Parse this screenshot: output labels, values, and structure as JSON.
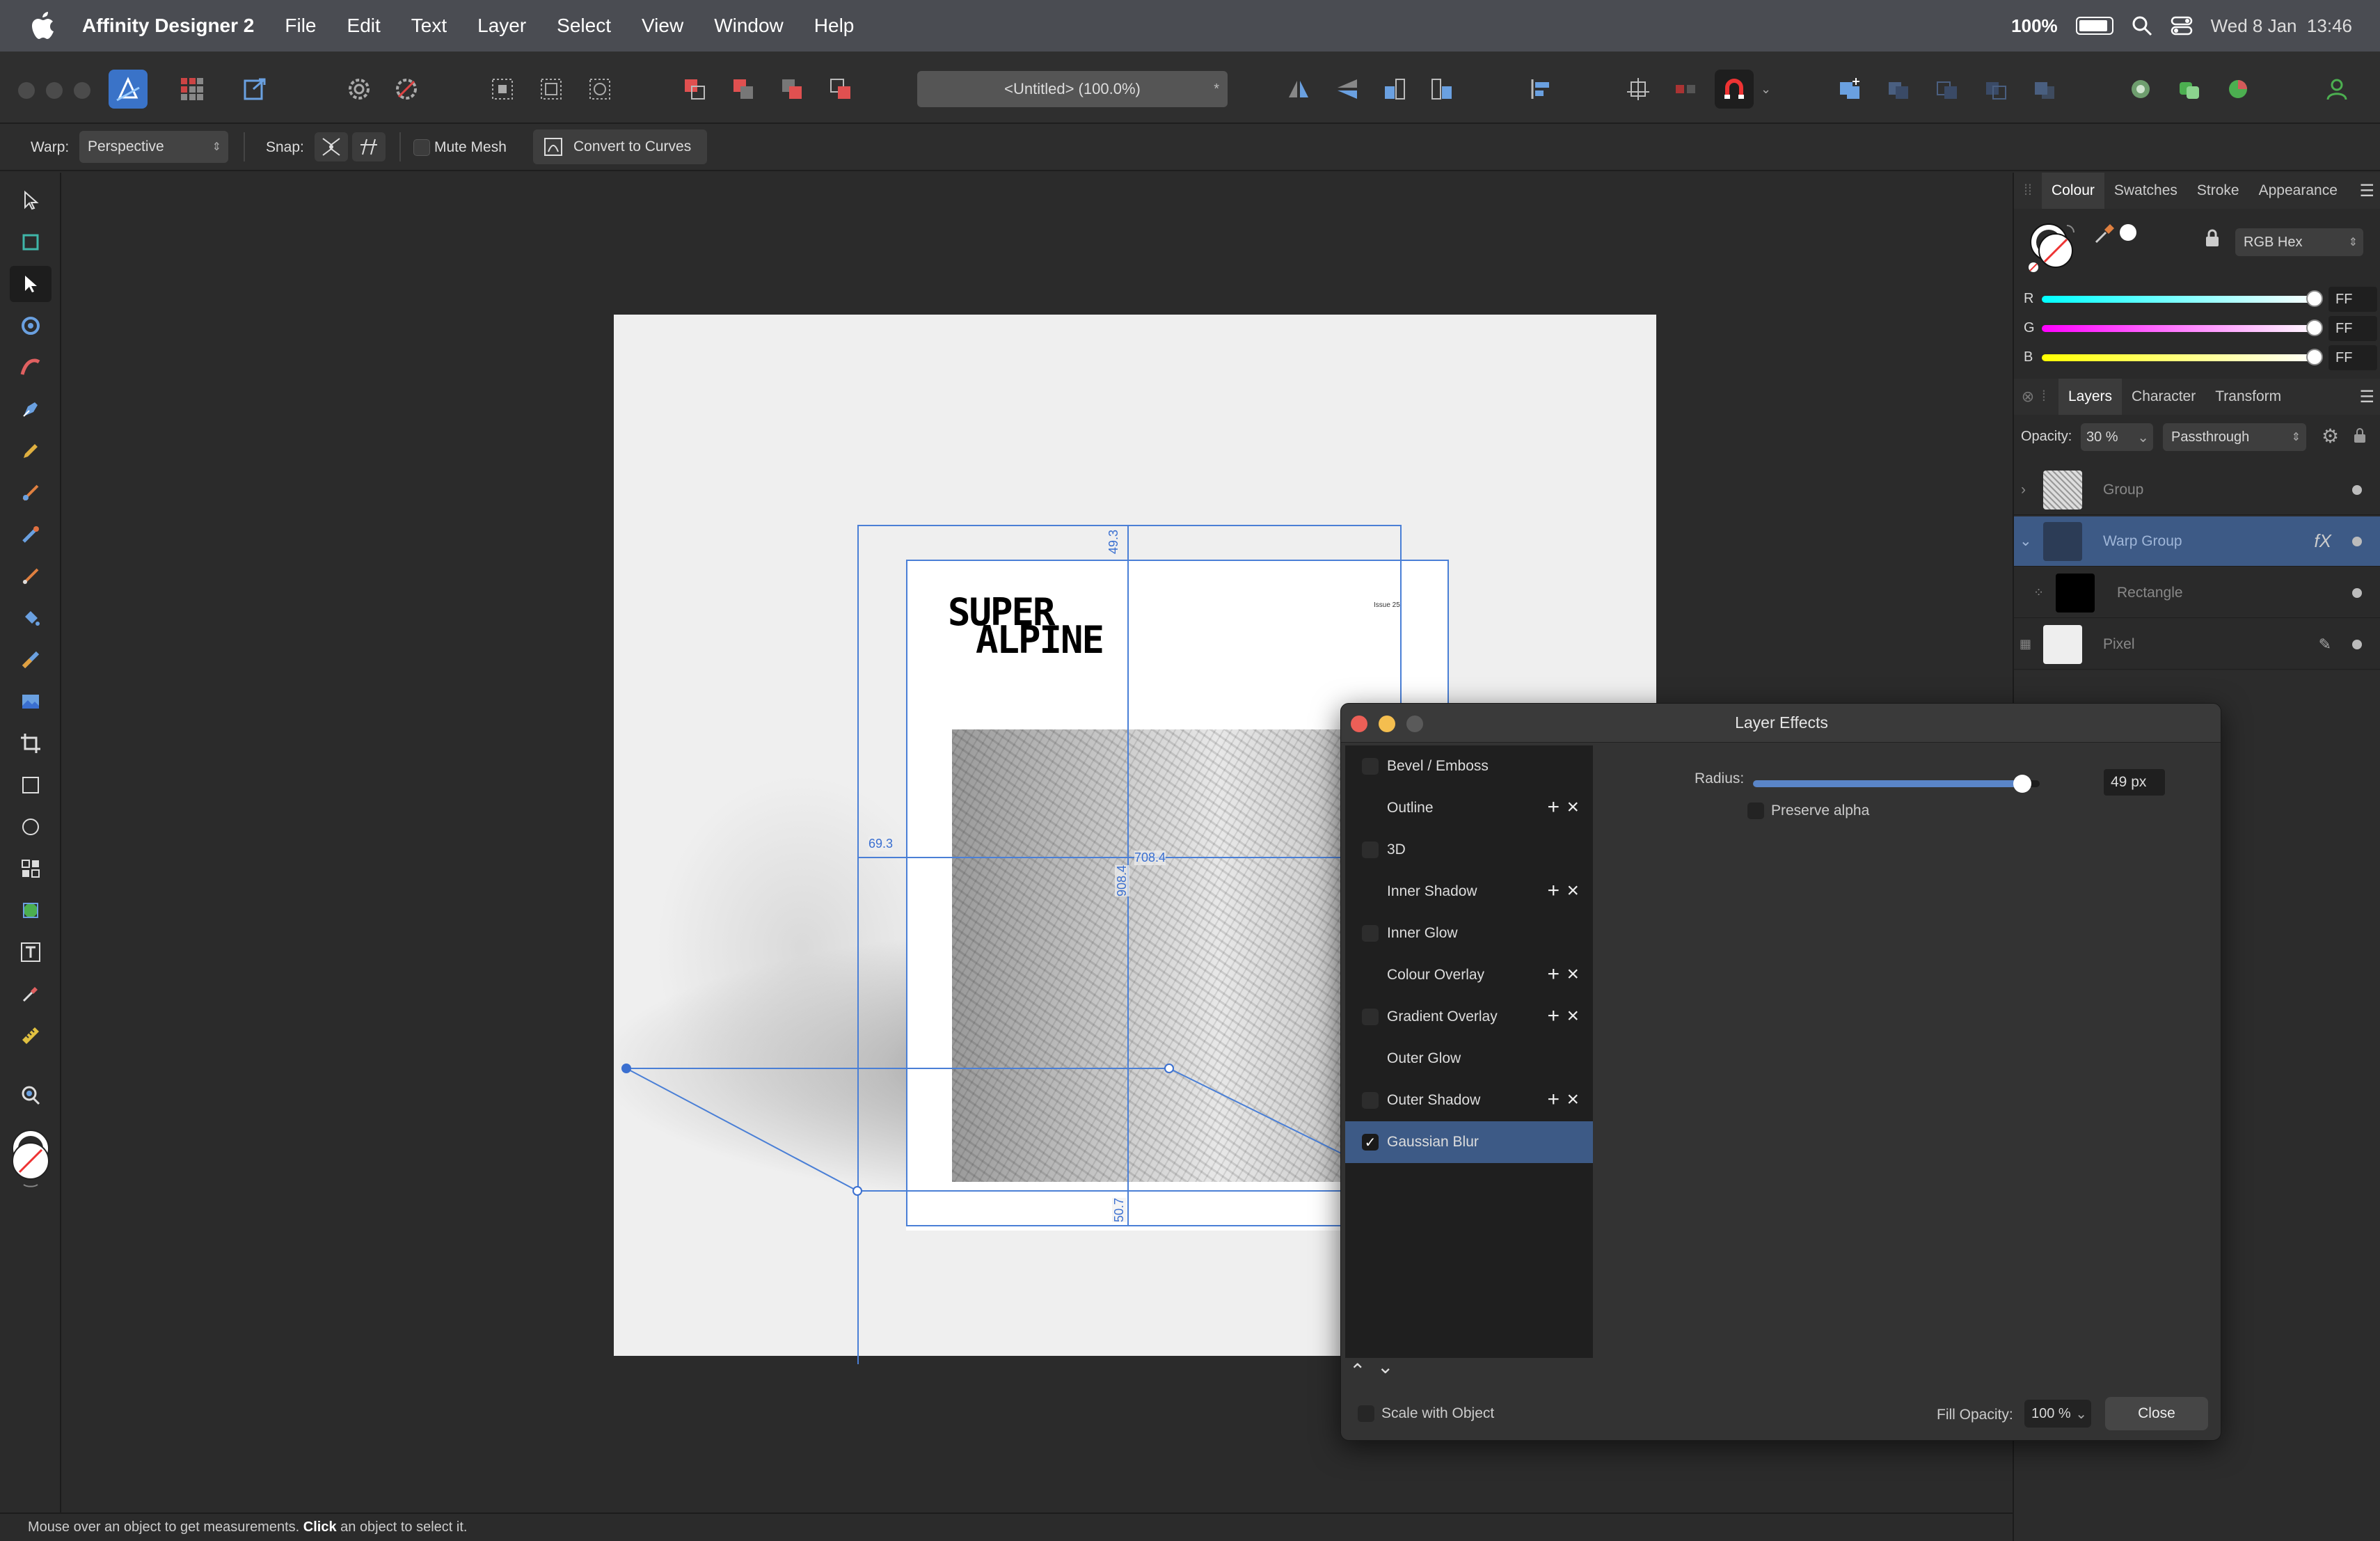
{
  "menubar": {
    "app_name": "Affinity Designer 2",
    "items": [
      "File",
      "Edit",
      "Text",
      "Layer",
      "Select",
      "View",
      "Window",
      "Help"
    ],
    "battery": "100%",
    "datetime": "Wed 8 Jan  13:46"
  },
  "toolbar": {
    "document_title": "<Untitled> (100.0%)",
    "star": "*"
  },
  "context": {
    "warp_label": "Warp:",
    "warp_value": "Perspective",
    "snap_label": "Snap:",
    "mute_mesh_label": "Mute Mesh",
    "convert_label": "Convert to Curves"
  },
  "artboard": {
    "poster_title_line1": "SUPER",
    "poster_title_line2": "ALPINE",
    "poster_issue": "Issue 25",
    "dimensions": {
      "top": "49.3",
      "left": "69.3",
      "width": "708.4",
      "height": "908.4",
      "bottom": "50.7"
    }
  },
  "colour_panel": {
    "tabs": [
      "Colour",
      "Swatches",
      "Stroke",
      "Appearance"
    ],
    "model": "RGB Hex",
    "channels": [
      {
        "label": "R",
        "value": "FF"
      },
      {
        "label": "G",
        "value": "FF"
      },
      {
        "label": "B",
        "value": "FF"
      }
    ]
  },
  "layers_panel": {
    "tabs": [
      "Layers",
      "Character",
      "Transform"
    ],
    "opacity_label": "Opacity:",
    "opacity_value": "30 %",
    "blend_mode": "Passthrough",
    "layers": [
      {
        "name": "Group"
      },
      {
        "name": "Warp Group"
      },
      {
        "name": "Rectangle"
      },
      {
        "name": "Pixel"
      }
    ]
  },
  "layer_effects": {
    "title": "Layer Effects",
    "effects": [
      {
        "name": "Bevel / Emboss",
        "addable": false
      },
      {
        "name": "Outline",
        "addable": true
      },
      {
        "name": "3D",
        "addable": false
      },
      {
        "name": "Inner Shadow",
        "addable": true
      },
      {
        "name": "Inner Glow",
        "addable": false
      },
      {
        "name": "Colour Overlay",
        "addable": true
      },
      {
        "name": "Gradient Overlay",
        "addable": true
      },
      {
        "name": "Outer Glow",
        "addable": false
      },
      {
        "name": "Outer Shadow",
        "addable": true
      },
      {
        "name": "Gaussian Blur",
        "addable": false,
        "checked": true
      }
    ],
    "radius_label": "Radius:",
    "radius_value": "49 px",
    "radius_fraction": 0.94,
    "preserve_alpha_label": "Preserve alpha",
    "scale_with_object_label": "Scale with Object",
    "fill_opacity_label": "Fill Opacity:",
    "fill_opacity_value": "100 %",
    "close_label": "Close"
  },
  "statusbar": {
    "text_before": "Mouse over an object to get measurements. ",
    "text_bold": "Click",
    "text_after": " an object to select it."
  },
  "colors": {
    "accent": "#3a73c8",
    "selection": "#3d5a86",
    "guide": "#4a7fd6"
  }
}
